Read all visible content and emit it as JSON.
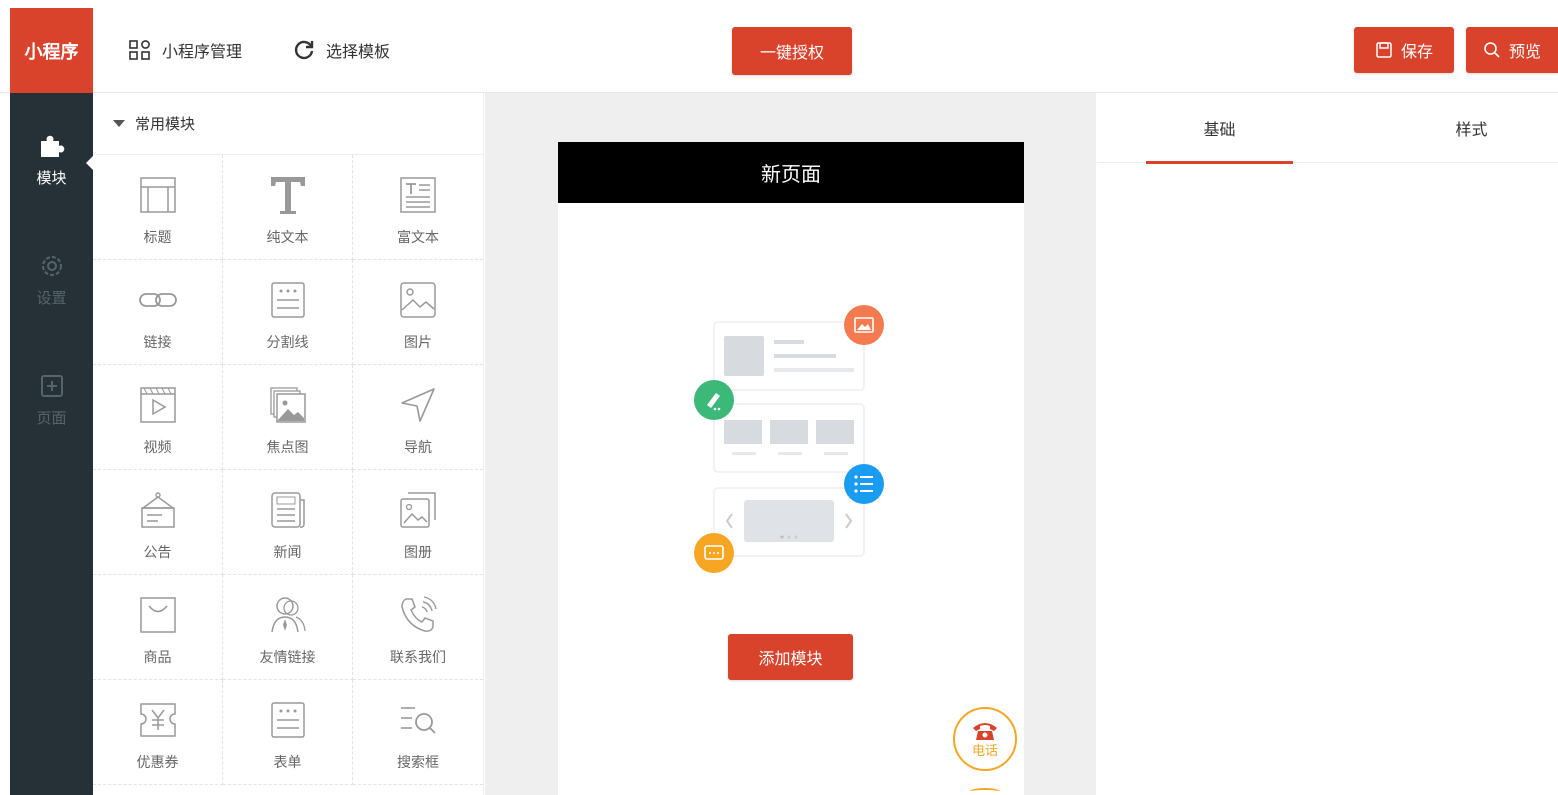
{
  "brand": {
    "label": "小程序"
  },
  "topbar": {
    "manage_label": "小程序管理",
    "template_label": "选择模板",
    "authorize_label": "一键授权",
    "save_label": "保存",
    "preview_label": "预览"
  },
  "sidebar": {
    "items": [
      {
        "label": "模块",
        "icon": "puzzle-icon",
        "active": true
      },
      {
        "label": "设置",
        "icon": "settings-icon",
        "active": false
      },
      {
        "label": "页面",
        "icon": "page-add-icon",
        "active": false
      }
    ]
  },
  "modules": {
    "section_title": "常用模块",
    "items": [
      {
        "label": "标题",
        "icon": "title-icon"
      },
      {
        "label": "纯文本",
        "icon": "text-icon"
      },
      {
        "label": "富文本",
        "icon": "rich-text-icon"
      },
      {
        "label": "链接",
        "icon": "link-icon"
      },
      {
        "label": "分割线",
        "icon": "divider-icon"
      },
      {
        "label": "图片",
        "icon": "image-icon"
      },
      {
        "label": "视频",
        "icon": "video-icon"
      },
      {
        "label": "焦点图",
        "icon": "carousel-icon"
      },
      {
        "label": "导航",
        "icon": "navigation-icon"
      },
      {
        "label": "公告",
        "icon": "notice-icon"
      },
      {
        "label": "新闻",
        "icon": "news-icon"
      },
      {
        "label": "图册",
        "icon": "album-icon"
      },
      {
        "label": "商品",
        "icon": "product-icon"
      },
      {
        "label": "友情链接",
        "icon": "friend-link-icon"
      },
      {
        "label": "联系我们",
        "icon": "contact-icon"
      },
      {
        "label": "优惠券",
        "icon": "coupon-icon"
      },
      {
        "label": "表单",
        "icon": "form-icon"
      },
      {
        "label": "搜索框",
        "icon": "search-box-icon"
      }
    ]
  },
  "canvas": {
    "page_title": "新页面",
    "add_module_label": "添加模块",
    "call_label": "电话"
  },
  "properties": {
    "tabs": [
      {
        "label": "基础",
        "active": true
      },
      {
        "label": "样式",
        "active": false
      }
    ]
  },
  "colors": {
    "accent": "#d9432c",
    "sidebar_bg": "#253137",
    "canvas_bg": "#efefef",
    "call_orange": "#f6a623"
  }
}
